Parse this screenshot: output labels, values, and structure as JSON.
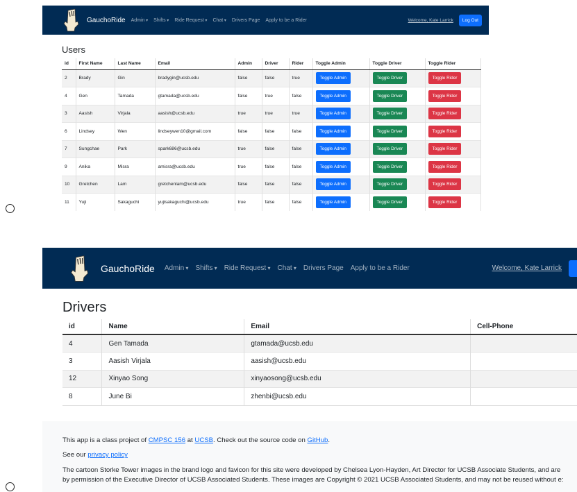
{
  "shot1": {
    "brand": "GauchoRide",
    "nav": [
      {
        "label": "Admin"
      },
      {
        "label": "Shifts"
      },
      {
        "label": "Ride Request"
      },
      {
        "label": "Chat"
      },
      {
        "label": "Drivers Page"
      },
      {
        "label": "Apply to be a Rider"
      }
    ],
    "welcome": "Welcome, Kate Larrick",
    "logout": "Log Out",
    "title": "Users",
    "columns": [
      "id",
      "First Name",
      "Last Name",
      "Email",
      "Admin",
      "Driver",
      "Rider",
      "Toggle Admin",
      "Toggle Driver",
      "Toggle Rider"
    ],
    "buttons": {
      "admin": "Toggle Admin",
      "driver": "Toggle Driver",
      "rider": "Toggle Rider"
    },
    "rows": [
      [
        "2",
        "Brady",
        "Gin",
        "bradygin@ucsb.edu",
        "false",
        "false",
        "true"
      ],
      [
        "4",
        "Gen",
        "Tamada",
        "gtamada@ucsb.edu",
        "false",
        "true",
        "false"
      ],
      [
        "3",
        "Aasish",
        "Virjala",
        "aasish@ucsb.edu",
        "true",
        "true",
        "true"
      ],
      [
        "6",
        "Lindsey",
        "Wen",
        "lindseywen10@gmail.com",
        "false",
        "false",
        "false"
      ],
      [
        "7",
        "Sungchae",
        "Park",
        "spark686@ucsb.edu",
        "true",
        "false",
        "false"
      ],
      [
        "9",
        "Anika",
        "Misra",
        "amisra@ucsb.edu",
        "true",
        "false",
        "false"
      ],
      [
        "10",
        "Gretchen",
        "Lam",
        "gretchenlam@ucsb.edu",
        "false",
        "false",
        "false"
      ],
      [
        "11",
        "Yuji",
        "Sakaguchi",
        "yujisakaguchi@ucsb.edu",
        "true",
        "false",
        "false"
      ]
    ]
  },
  "shot2": {
    "brand": "GauchoRide",
    "nav": [
      {
        "label": "Admin"
      },
      {
        "label": "Shifts"
      },
      {
        "label": "Ride Request"
      },
      {
        "label": "Chat"
      },
      {
        "label": "Drivers Page"
      },
      {
        "label": "Apply to be a Rider"
      }
    ],
    "welcome": "Welcome, Kate Larrick",
    "title": "Drivers",
    "columns": [
      "id",
      "Name",
      "Email",
      "Cell-Phone"
    ],
    "rows": [
      [
        "4",
        "Gen Tamada",
        "gtamada@ucsb.edu",
        ""
      ],
      [
        "3",
        "Aasish Virjala",
        "aasish@ucsb.edu",
        ""
      ],
      [
        "12",
        "Xinyao Song",
        "xinyaosong@ucsb.edu",
        ""
      ],
      [
        "8",
        "June Bi",
        "zhenbi@ucsb.edu",
        ""
      ]
    ],
    "footer": {
      "p1_a": "This app is a class project of ",
      "p1_link1": "CMPSC 156",
      "p1_b": " at ",
      "p1_link2": "UCSB",
      "p1_c": ". Check out the source code on ",
      "p1_link3": "GitHub",
      "p1_d": ".",
      "p2_a": "See our ",
      "p2_link": "privacy policy",
      "p3_line1": "The cartoon Storke Tower images in the brand logo and favicon for this site were developed by Chelsea Lyon-Hayden, Art Director for UCSB Associate Students, and are",
      "p3_line2": "by permission of the Executive Director of UCSB Associated Students. These images are Copyright © 2021 UCSB Associated Students, and may not be reused without e:"
    }
  },
  "colors": {
    "navbar": "#012b54",
    "primary": "#0d6efd",
    "success": "#198754",
    "danger": "#dc3545"
  }
}
